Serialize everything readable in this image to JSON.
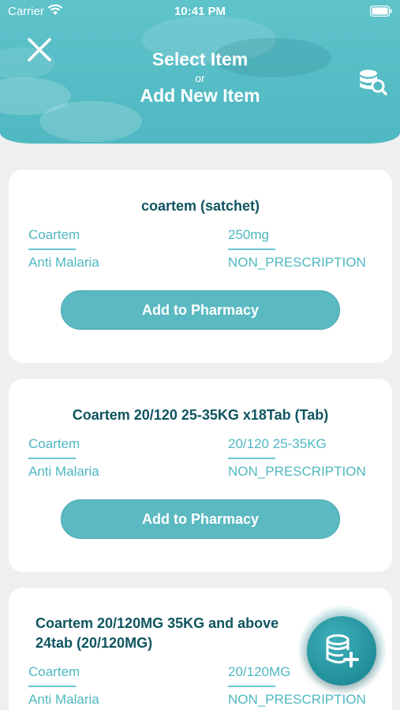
{
  "status_bar": {
    "carrier": "Carrier",
    "time": "10:41 PM"
  },
  "header": {
    "title_line1": "Select Item",
    "title_or": "or",
    "title_line2": "Add New Item"
  },
  "items": [
    {
      "title": "coartem (satchet)",
      "brand": "Coartem",
      "strength": "250mg",
      "category": "Anti Malaria",
      "prescription": "NON_PRESCRIPTION",
      "button_label": "Add to Pharmacy"
    },
    {
      "title": "Coartem 20/120 25-35KG x18Tab (Tab)",
      "brand": "Coartem",
      "strength": "20/120 25-35KG",
      "category": "Anti Malaria",
      "prescription": "NON_PRESCRIPTION",
      "button_label": "Add to Pharmacy"
    },
    {
      "title": "Coartem 20/120MG 35KG and above 24tab (20/120MG)",
      "brand": "Coartem",
      "strength": "20/120MG",
      "category": "Anti Malaria",
      "prescription": "NON_PRESCRIPTION"
    }
  ],
  "icons": {
    "close": "close-icon",
    "search_database": "database-search-icon",
    "add_database": "database-add-icon"
  },
  "colors": {
    "header": "#4fb8c1",
    "accent_text": "#4fb8c1",
    "title_text": "#0f5560",
    "button": "#5bb9c2",
    "fab": "#1f8c97"
  }
}
